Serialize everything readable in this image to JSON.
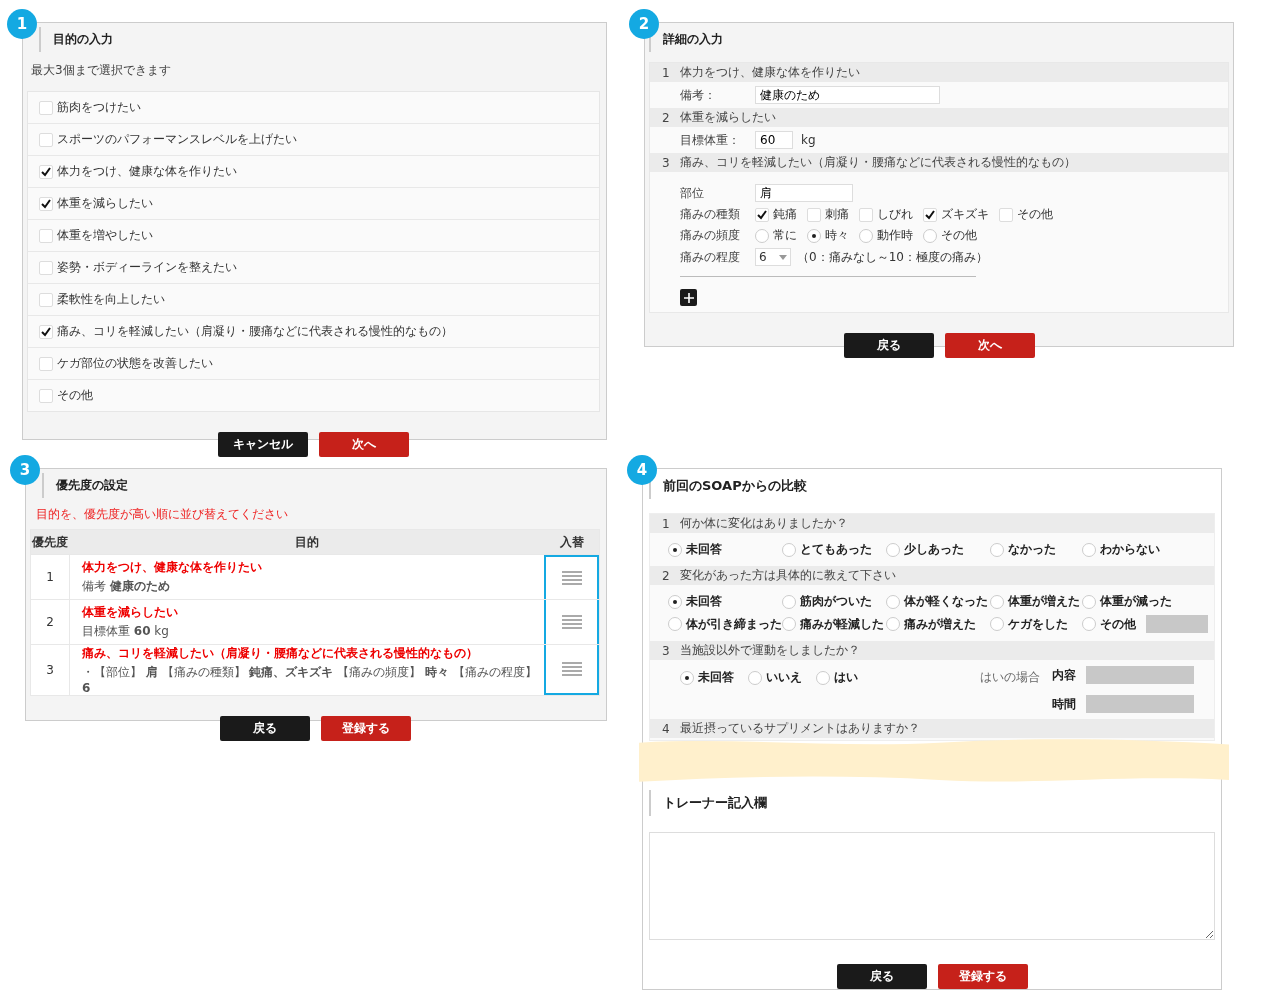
{
  "step1": {
    "badge": "1",
    "title": "目的の入力",
    "note": "最大3個まで選択できます",
    "options": [
      {
        "label": "筋肉をつけたい",
        "checked": false
      },
      {
        "label": "スポーツのパフォーマンスレベルを上げたい",
        "checked": false
      },
      {
        "label": "体力をつけ、健康な体を作りたい",
        "checked": true
      },
      {
        "label": "体重を減らしたい",
        "checked": true
      },
      {
        "label": "体重を増やしたい",
        "checked": false
      },
      {
        "label": "姿勢・ボディーラインを整えたい",
        "checked": false
      },
      {
        "label": "柔軟性を向上したい",
        "checked": false
      },
      {
        "label": "痛み、コリを軽減したい（肩凝り・腰痛などに代表される慢性的なもの）",
        "checked": true
      },
      {
        "label": "ケガ部位の状態を改善したい",
        "checked": false
      },
      {
        "label": "その他",
        "checked": false
      }
    ],
    "buttons": [
      {
        "label": "キャンセル",
        "kind": "secondary"
      },
      {
        "label": "次へ",
        "kind": "primary"
      }
    ]
  },
  "step2": {
    "badge": "2",
    "title": "詳細の入力",
    "sections": [
      {
        "number": "1",
        "title": "体力をつけ、健康な体を作りたい",
        "fields": [
          {
            "kind": "text",
            "label": "備考：",
            "value": "健康のため"
          }
        ]
      },
      {
        "number": "2",
        "title": "体重を減らしたい",
        "fields": [
          {
            "kind": "short",
            "label": "目標体重：",
            "value": "60",
            "unit": "kg"
          }
        ]
      },
      {
        "number": "3",
        "title": "痛み、コリを軽減したい（肩凝り・腰痛などに代表される慢性的なもの）",
        "add_button": true,
        "fields": [
          {
            "kind": "medium",
            "label": "部位",
            "value": "肩"
          },
          {
            "kind": "checkboxes",
            "label": "痛みの種類",
            "options": [
              {
                "label": "鈍痛",
                "checked": true
              },
              {
                "label": "刺痛",
                "checked": false
              },
              {
                "label": "しびれ",
                "checked": false
              },
              {
                "label": "ズキズキ",
                "checked": true
              },
              {
                "label": "その他",
                "checked": false
              }
            ]
          },
          {
            "kind": "radios",
            "label": "痛みの頻度",
            "options": [
              {
                "label": "常に",
                "selected": false
              },
              {
                "label": "時々",
                "selected": true
              },
              {
                "label": "動作時",
                "selected": false
              },
              {
                "label": "その他",
                "selected": false
              }
            ]
          },
          {
            "kind": "select",
            "label": "痛みの程度",
            "value": "6",
            "hint": "（0：痛みなし～10：極度の痛み）"
          }
        ]
      }
    ],
    "buttons": [
      {
        "label": "戻る",
        "kind": "secondary"
      },
      {
        "label": "次へ",
        "kind": "primary"
      }
    ]
  },
  "step3": {
    "badge": "3",
    "title": "優先度の設定",
    "note": "目的を、優先度が高い順に並び替えてください",
    "drag_column_highlighted": true,
    "columns": [
      "優先度",
      "目的",
      "入替"
    ],
    "rows": [
      {
        "priority": "1",
        "goal": "体力をつけ、健康な体を作りたい",
        "detail": "備考 **健康のため**"
      },
      {
        "priority": "2",
        "goal": "体重を減らしたい",
        "detail": "目標体重 **60** kg"
      },
      {
        "priority": "3",
        "goal": "痛み、コリを軽減したい（肩凝り・腰痛などに代表される慢性的なもの）",
        "detail": "・【部位】 **肩** 【痛みの種類】 **鈍痛、ズキズキ** 【痛みの頻度】 **時々** 【痛みの程度】 **6**"
      }
    ],
    "buttons": [
      {
        "label": "戻る",
        "kind": "secondary"
      },
      {
        "label": "登録する",
        "kind": "primary"
      }
    ]
  },
  "step4": {
    "badge": "4",
    "title": "前回のSOAPからの比較",
    "questions": [
      {
        "number": "1",
        "text": "何か体に変化はありましたか？",
        "kind": "grid",
        "options": [
          {
            "label": "未回答",
            "selected": true
          },
          {
            "label": "とてもあった",
            "selected": false
          },
          {
            "label": "少しあった",
            "selected": false
          },
          {
            "label": "なかった",
            "selected": false
          },
          {
            "label": "わからない",
            "selected": false
          }
        ]
      },
      {
        "number": "2",
        "text": "変化があった方は具体的に教えて下さい",
        "kind": "grid",
        "other_field": true,
        "options": [
          {
            "label": "未回答",
            "selected": true
          },
          {
            "label": "筋肉がついた",
            "selected": false
          },
          {
            "label": "体が軽くなった",
            "selected": false
          },
          {
            "label": "体重が増えた",
            "selected": false
          },
          {
            "label": "体重が減った",
            "selected": false
          },
          {
            "label": "体が引き締まった",
            "selected": false
          },
          {
            "label": "痛みが軽減した",
            "selected": false
          },
          {
            "label": "痛みが増えた",
            "selected": false
          },
          {
            "label": "ケガをした",
            "selected": false
          },
          {
            "label": "その他",
            "selected": false
          }
        ]
      },
      {
        "number": "3",
        "text": "当施設以外で運動をしましたか？",
        "kind": "inline",
        "if_yes": "はいの場合",
        "extra_fields": [
          "内容",
          "時間"
        ],
        "options": [
          {
            "label": "未回答",
            "selected": true
          },
          {
            "label": "いいえ",
            "selected": false
          },
          {
            "label": "はい",
            "selected": false
          }
        ]
      },
      {
        "number": "4",
        "text": "最近摂っているサプリメントはありますか？",
        "kind": "covered"
      }
    ],
    "trainer_title": "トレーナー記入欄",
    "buttons": [
      {
        "label": "戻る",
        "kind": "secondary"
      },
      {
        "label": "登録する",
        "kind": "primary"
      }
    ]
  }
}
